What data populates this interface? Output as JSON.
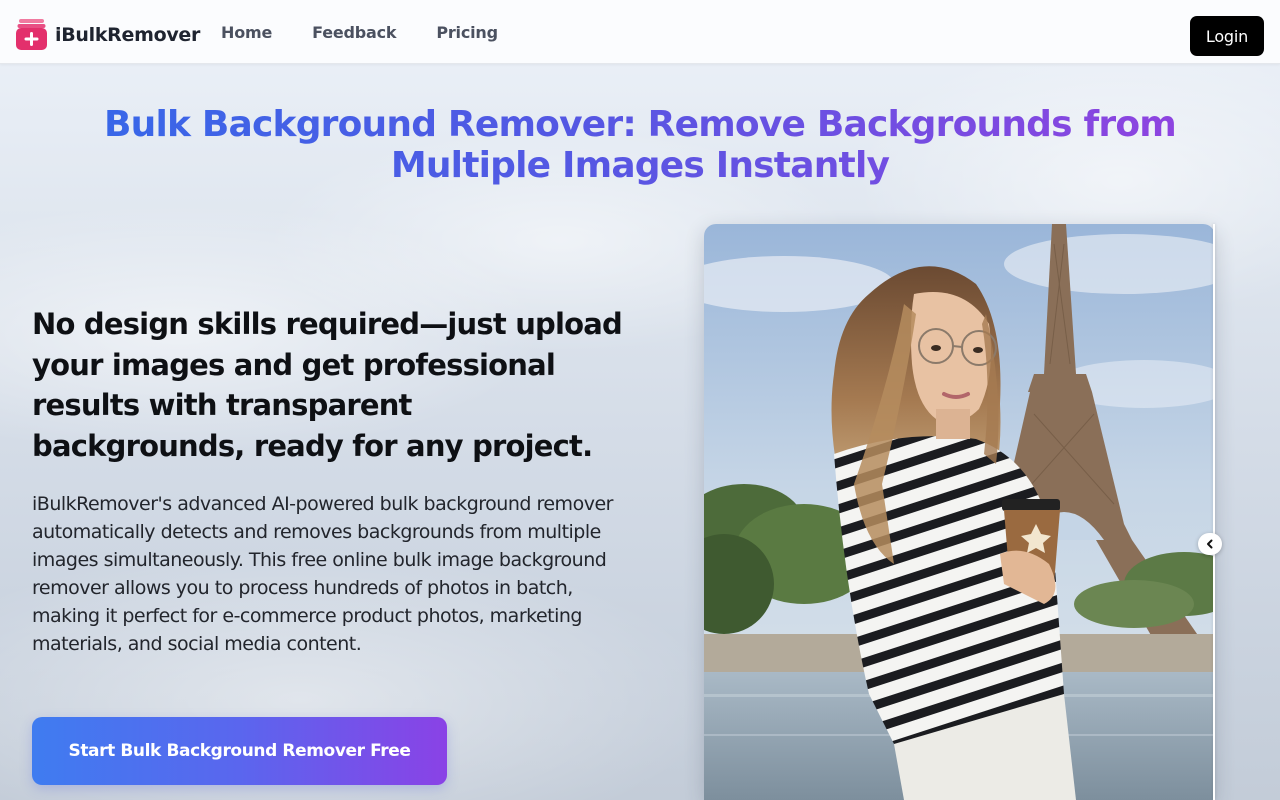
{
  "brand": {
    "name": "iBulkRemover",
    "logo_icon": "add-image-icon",
    "accent": "#e3306c"
  },
  "nav": {
    "items": [
      {
        "label": "Home"
      },
      {
        "label": "Feedback"
      },
      {
        "label": "Pricing"
      }
    ],
    "login_label": "Login"
  },
  "hero": {
    "title_line1": "Bulk Background Remover: Remove Backgrounds from",
    "title_line2": "Multiple Images Instantly",
    "subhead": "No design skills required—just upload your images and get professional results with transparent backgrounds, ready for any project.",
    "description": "iBulkRemover's advanced AI-powered bulk background remover automatically detects and removes backgrounds from multiple images simultaneously. This free online bulk image background remover allows you to process hundreds of photos in batch, making it perfect for e-commerce product photos, marketing materials, and social media content.",
    "cta_label": "Start Bulk Background Remover Free"
  },
  "compare": {
    "handle_icon": "chevron-left-icon",
    "title_gradient": [
      "#3867e8",
      "#8e44e0"
    ],
    "cta_gradient": [
      "#3f7cf0",
      "#8a42e6"
    ]
  }
}
